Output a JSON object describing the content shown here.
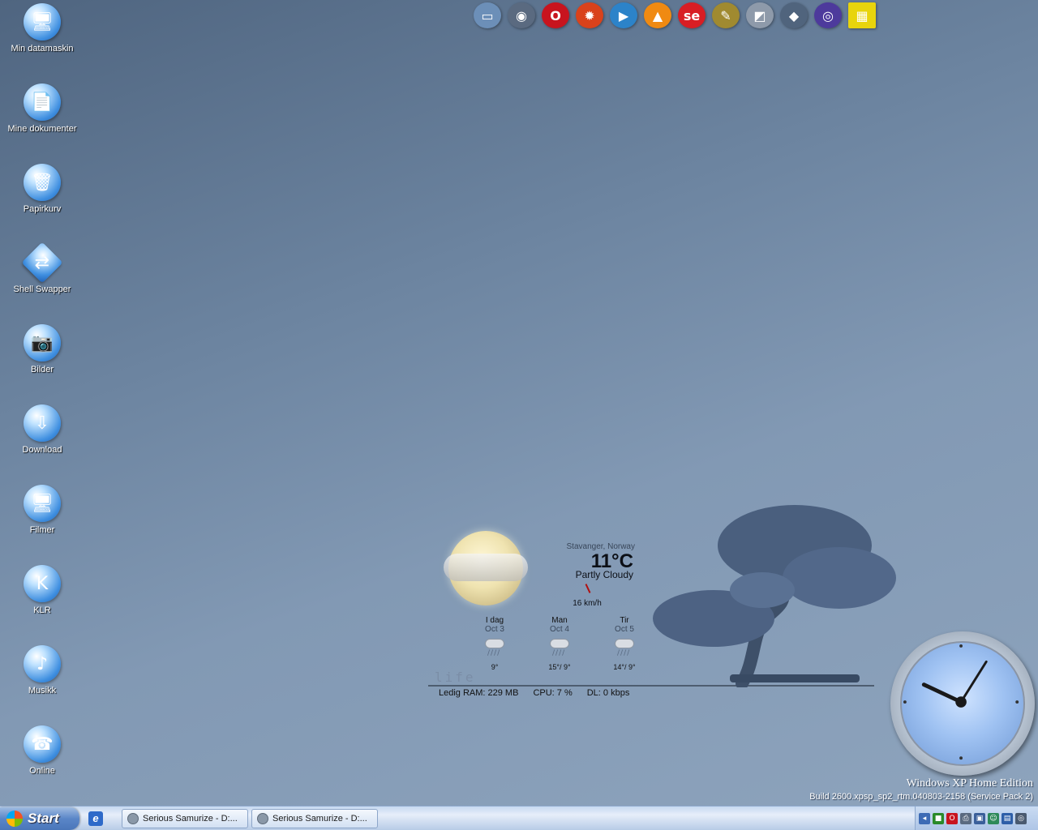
{
  "desktop_icons": [
    {
      "label": "Min datamaskin",
      "icon": "my-computer-icon",
      "glyph": "🖥"
    },
    {
      "label": "Mine dokumenter",
      "icon": "my-documents-icon",
      "glyph": "📄"
    },
    {
      "label": "Papirkurv",
      "icon": "recycle-bin-icon",
      "glyph": "🗑"
    },
    {
      "label": "Shell Swapper",
      "icon": "shell-swapper-icon",
      "glyph": "⇄"
    },
    {
      "label": "Bilder",
      "icon": "camera-icon",
      "glyph": "📷"
    },
    {
      "label": "Download",
      "icon": "download-icon",
      "glyph": "⇩"
    },
    {
      "label": "Filmer",
      "icon": "monitor-icon",
      "glyph": "🖥"
    },
    {
      "label": "KLR",
      "icon": "klr-icon",
      "glyph": "K"
    },
    {
      "label": "Musikk",
      "icon": "music-note-icon",
      "glyph": "♪"
    },
    {
      "label": "Online",
      "icon": "telephone-icon",
      "glyph": "☎"
    }
  ],
  "dock_icons": [
    {
      "icon": "computer-icon",
      "glyph": "▭",
      "color": "#6c8fb8"
    },
    {
      "icon": "globe-icon",
      "glyph": "◉",
      "color": "#5a6a80"
    },
    {
      "icon": "opera-icon",
      "glyph": "O",
      "color": "#c8141e"
    },
    {
      "icon": "firefox-icon",
      "glyph": "✹",
      "color": "#d9421b"
    },
    {
      "icon": "media-player-icon",
      "glyph": "▶",
      "color": "#2c83c9"
    },
    {
      "icon": "vlc-icon",
      "glyph": "▲",
      "color": "#f08a12"
    },
    {
      "icon": "se-icon",
      "glyph": "se",
      "color": "#d81e24"
    },
    {
      "icon": "pencils-icon",
      "glyph": "✎",
      "color": "#a08a30"
    },
    {
      "icon": "notepad-icon",
      "glyph": "◩",
      "color": "#8e9aaa"
    },
    {
      "icon": "tablet-icon",
      "glyph": "◆",
      "color": "#50647d"
    },
    {
      "icon": "disc-icon",
      "glyph": "◎",
      "color": "#4d3a9c"
    },
    {
      "icon": "checkered-flag-icon",
      "glyph": "▦",
      "color": "#e8d40c"
    }
  ],
  "weather": {
    "location": "Stavanger, Norway",
    "temperature": "11°C",
    "condition": "Partly Cloudy",
    "wind": "16 km/h",
    "forecast": [
      {
        "day": "I dag",
        "date": "Oct 3",
        "temp": "9°"
      },
      {
        "day": "Man",
        "date": "Oct 4",
        "temp": "15°/ 9°"
      },
      {
        "day": "Tir",
        "date": "Oct 5",
        "temp": "14°/ 9°"
      }
    ]
  },
  "widget": {
    "life_text": "life",
    "ram": "Ledig RAM: 229 MB",
    "cpu": "CPU: 7 %",
    "dl": "DL: 0 kbps"
  },
  "watermark": {
    "edition": "Windows XP Home Edition",
    "build": "Build 2600.xpsp_sp2_rtm.040803-2158 (Service Pack 2)"
  },
  "taskbar": {
    "start_label": "Start",
    "quicklaunch_glyph": "e",
    "tasks": [
      {
        "label": "Serious Samurize - D:..."
      },
      {
        "label": "Serious Samurize - D:..."
      }
    ],
    "tray_icons": [
      {
        "icon": "arrow-left-icon",
        "glyph": "◂",
        "color": "#3d6bb5"
      },
      {
        "icon": "green-status-icon",
        "glyph": "■",
        "color": "#2a8a2a"
      },
      {
        "icon": "opera-tray-icon",
        "glyph": "O",
        "color": "#c8141e"
      },
      {
        "icon": "printer-icon",
        "glyph": "⎙",
        "color": "#5a6a80"
      },
      {
        "icon": "network-icon",
        "glyph": "▣",
        "color": "#3a5f9a"
      },
      {
        "icon": "user-icon",
        "glyph": "☺",
        "color": "#2d8a5a"
      },
      {
        "icon": "display-icon",
        "glyph": "▤",
        "color": "#2e5fa8"
      },
      {
        "icon": "cd-tray-icon",
        "glyph": "◎",
        "color": "#4a5a70"
      }
    ]
  }
}
